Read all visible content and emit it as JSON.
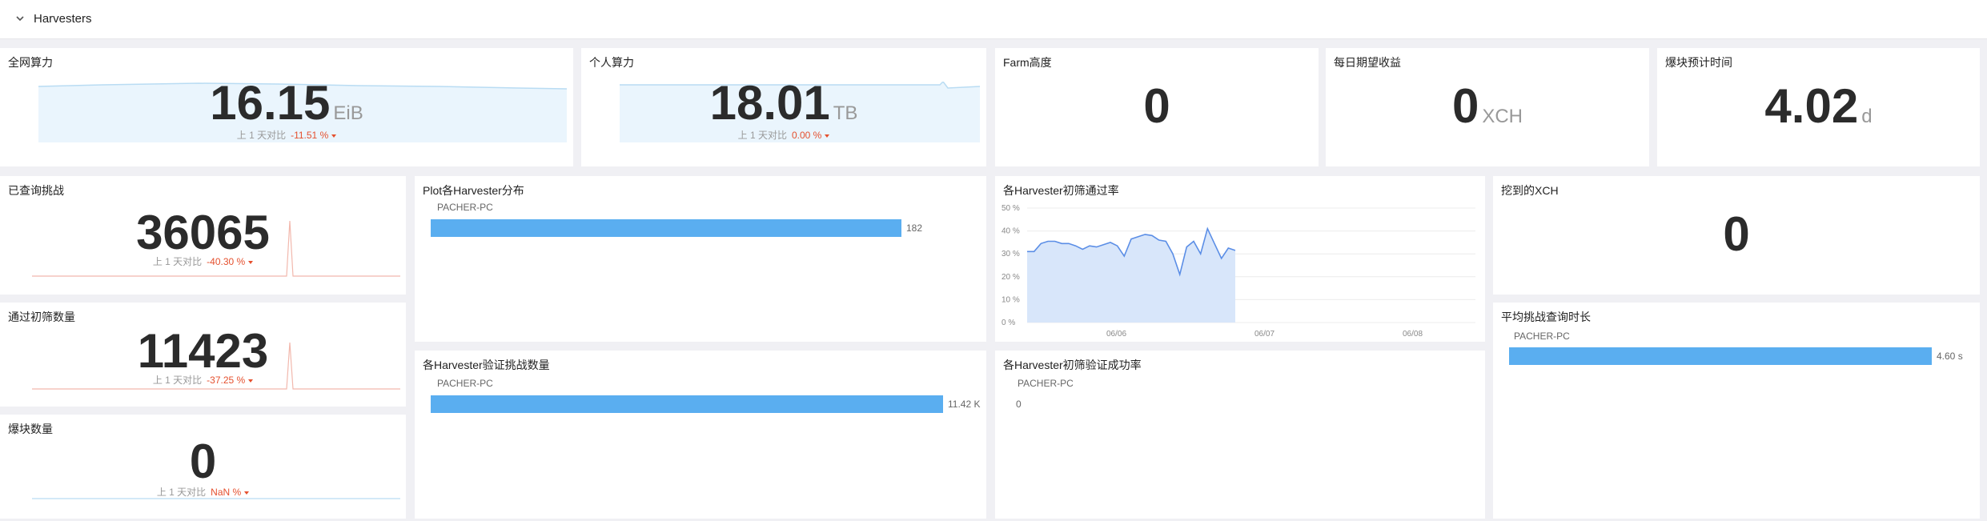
{
  "header": {
    "title": "Harvesters"
  },
  "colors": {
    "accent": "#5aaef0",
    "down": "#e5502e"
  },
  "panels": {
    "net_power": {
      "title": "全网算力",
      "value": "16.15",
      "unit": "EiB",
      "cmp_label": "上 1 天对比",
      "cmp_pct": "-11.51 %"
    },
    "personal_power": {
      "title": "个人算力",
      "value": "18.01",
      "unit": "TB",
      "cmp_label": "上 1 天对比",
      "cmp_pct": "0.00 %"
    },
    "farm_height": {
      "title": "Farm高度",
      "value": "0"
    },
    "daily_income": {
      "title": "每日期望收益",
      "value": "0",
      "unit": "XCH"
    },
    "block_eta": {
      "title": "爆块预计时间",
      "value": "4.02",
      "unit": "d"
    },
    "challenges": {
      "title": "已查询挑战",
      "value": "36065",
      "cmp_label": "上 1 天对比",
      "cmp_pct": "-40.30 %"
    },
    "passed": {
      "title": "通过初筛数量",
      "value": "11423",
      "cmp_label": "上 1 天对比",
      "cmp_pct": "-37.25 %"
    },
    "blocks": {
      "title": "爆块数量",
      "value": "0",
      "cmp_label": "上 1 天对比",
      "cmp_pct": "NaN %"
    },
    "plot_dist": {
      "title": "Plot各Harvester分布",
      "rows": [
        {
          "label": "PACHER-PC",
          "value": 182,
          "value_label": "182"
        }
      ],
      "max": 195
    },
    "verify_count": {
      "title": "各Harvester验证挑战数量",
      "rows": [
        {
          "label": "PACHER-PC",
          "value": 11420,
          "value_label": "11.42 K"
        }
      ],
      "max": 11600
    },
    "pass_rate": {
      "title": "各Harvester初筛通过率"
    },
    "verify_success": {
      "title": "各Harvester初筛验证成功率",
      "rows": [
        {
          "label": "PACHER-PC",
          "value_label": "0"
        }
      ]
    },
    "mined_xch": {
      "title": "挖到的XCH",
      "value": "0"
    },
    "avg_query": {
      "title": "平均挑战查询时长",
      "rows": [
        {
          "label": "PACHER-PC",
          "value": 4.6,
          "value_label": "4.60 s"
        }
      ],
      "max": 4.75
    }
  },
  "chart_data": {
    "type": "area",
    "title": "各Harvester初筛通过率",
    "y_ticks": [
      "0 %",
      "10 %",
      "20 %",
      "30 %",
      "40 %",
      "50 %"
    ],
    "x_ticks": [
      "06/06",
      "06/07",
      "06/08"
    ],
    "ylim": [
      0,
      50
    ],
    "grid": true,
    "series": [
      {
        "values": [
          31,
          31,
          34.5,
          35.5,
          35.5,
          34.5,
          34.5,
          33.5,
          32,
          33.5,
          33,
          34,
          35,
          33.5,
          29,
          36.5,
          37.5,
          38.5,
          38,
          36,
          35.5,
          30,
          21,
          33,
          35.5,
          30,
          41,
          34.5,
          28,
          32.5,
          31.5
        ]
      }
    ]
  }
}
